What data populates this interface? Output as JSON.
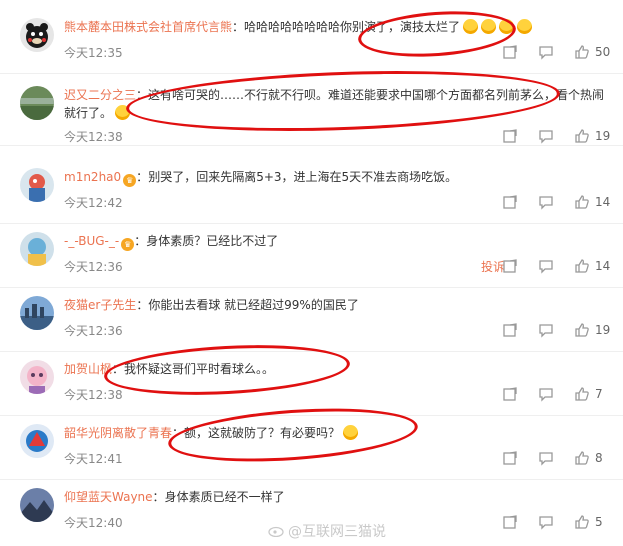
{
  "comments": [
    {
      "user": "熊本麓本田株式会社首席代言熊",
      "text": "哈哈哈哈哈哈哈哈你别演了，演技太烂了",
      "time": "今天12:35",
      "likes": "50",
      "has_badge": false,
      "emoji_count": 4,
      "emoji_icon": "laughing-emoji"
    },
    {
      "user": "迟又二分之三",
      "text": "这有啥可哭的……不行就不行呗。难道还能要求中国哪个方面都名列前茅么，看个热闹就行了。",
      "time": "今天12:38",
      "likes": "19",
      "has_badge": false,
      "emoji_count": 1,
      "emoji_icon": "thinking-emoji"
    },
    {
      "user": "m1n2ha0",
      "text": "别哭了，回来先隔离5+3，进上海在5天不准去商场吃饭。",
      "time": "今天12:42",
      "likes": "14",
      "has_badge": true
    },
    {
      "user": "-_-BUG-_-",
      "text": "身体素质？已经比不过了",
      "time": "今天12:36",
      "likes": "14",
      "has_badge": true,
      "report": "投诉"
    },
    {
      "user": "夜猫er子先生",
      "text": "你能出去看球 就已经超过99%的国民了",
      "time": "今天12:36",
      "likes": "19",
      "has_badge": false
    },
    {
      "user": "加贺山枫",
      "text": "我怀疑这哥们平时看球么。。",
      "time": "今天12:38",
      "likes": "7",
      "has_badge": false
    },
    {
      "user": "韶华光阴离散了青春",
      "text": "额，这就破防了？有必要吗？",
      "time": "今天12:41",
      "likes": "8",
      "has_badge": false,
      "emoji_count": 1,
      "emoji_icon": "smirk-emoji"
    },
    {
      "user": "仰望蓝天Wayne",
      "text": "身体素质已经不一样了",
      "time": "今天12:40",
      "likes": "5",
      "has_badge": false
    }
  ],
  "icons": {
    "share": "share-icon",
    "comment": "comment-icon",
    "like": "thumbs-up-icon",
    "badge": "member-badge-icon"
  },
  "colors": {
    "username": "#eb7350",
    "annotation": "#e01010",
    "time": "#888888"
  },
  "watermark": "@互联网三猫说"
}
